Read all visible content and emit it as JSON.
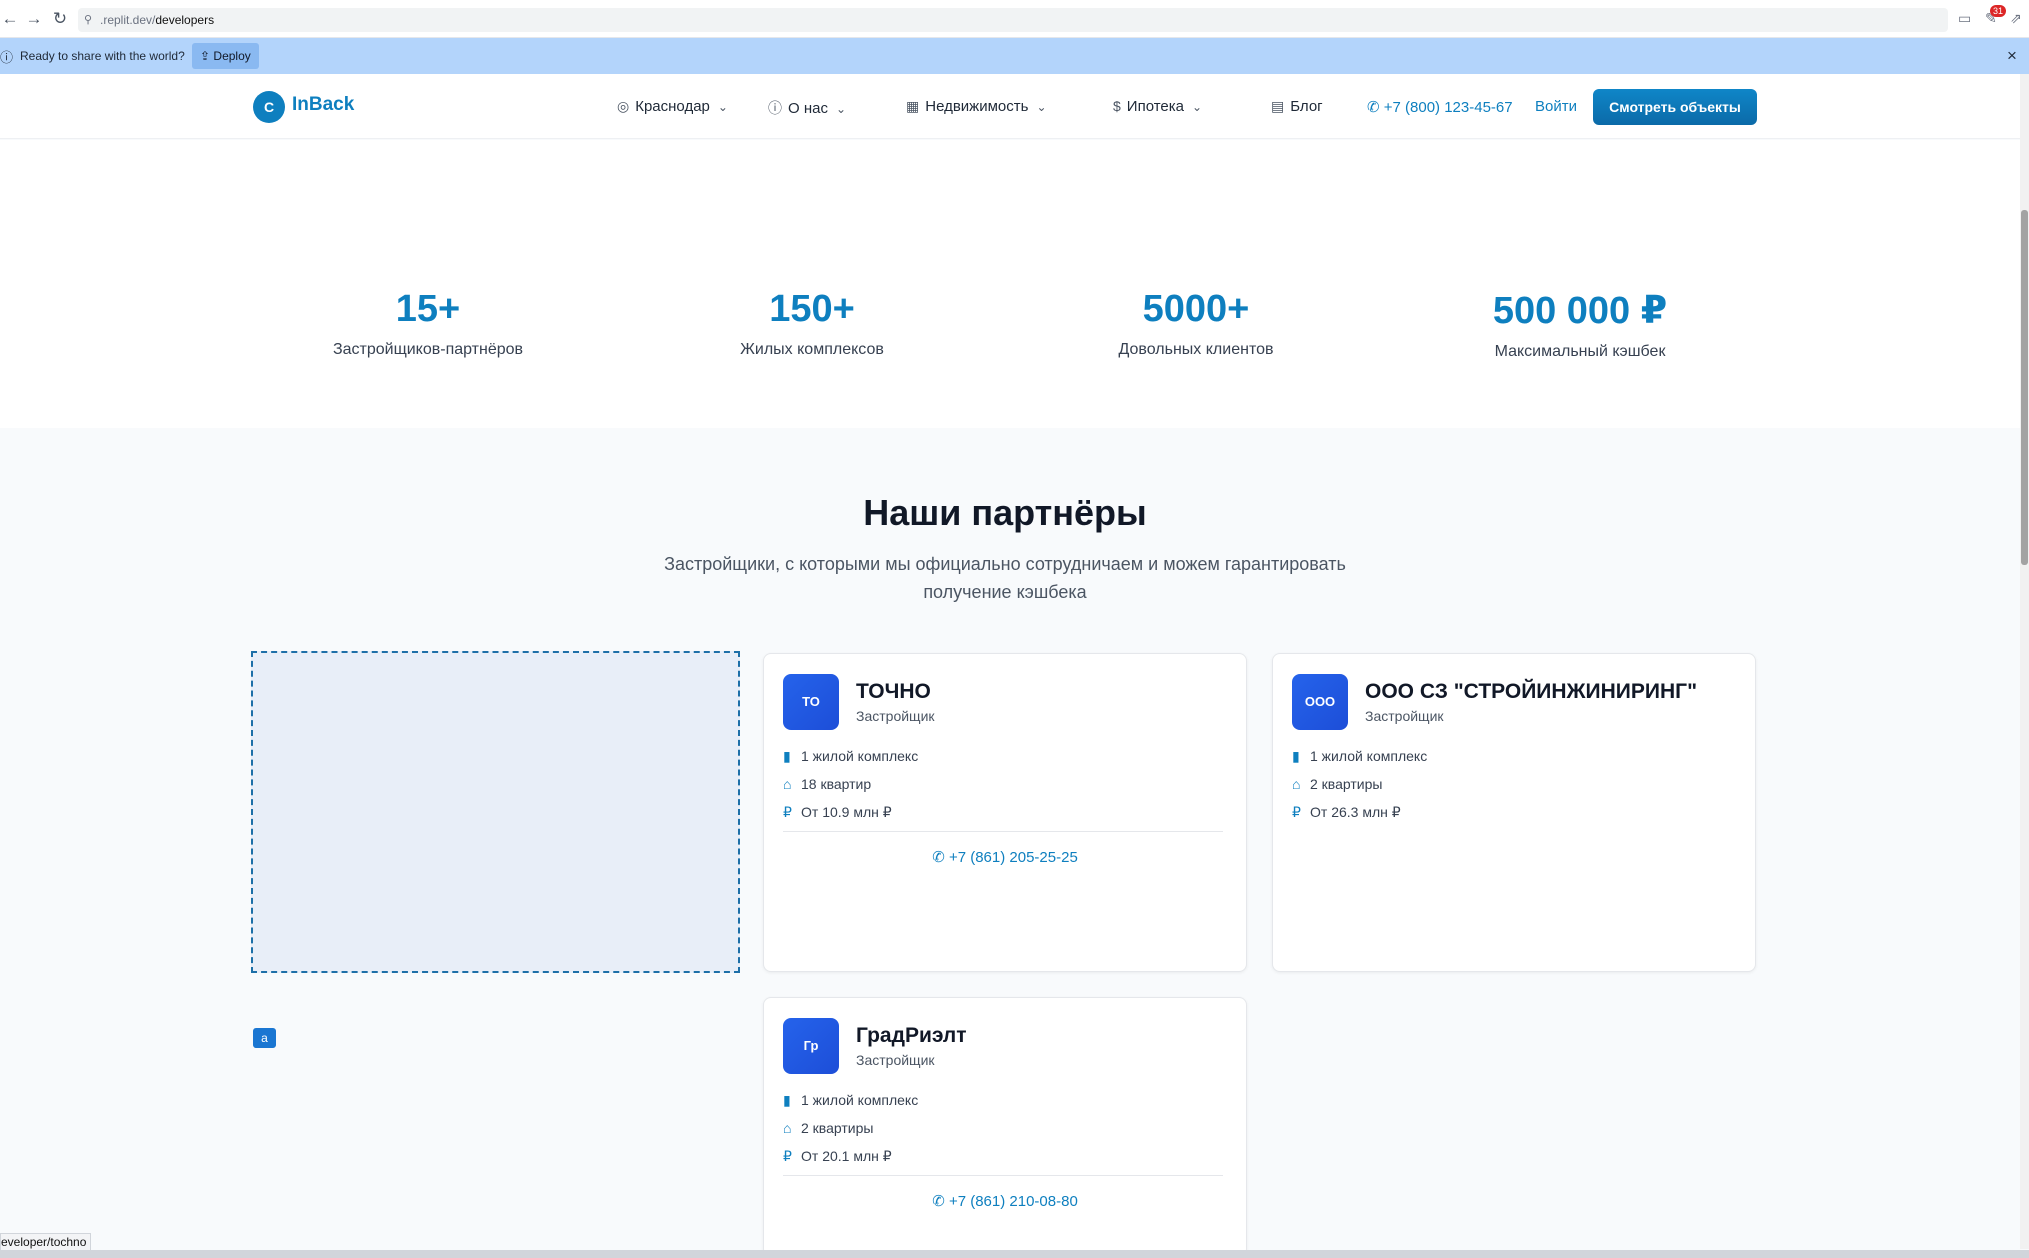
{
  "browser": {
    "url_prefix": ".replit.dev/",
    "url_path": "developers",
    "extension_badge": "31"
  },
  "notice": {
    "text": "Ready to share with the world?",
    "deploy_label": "Deploy"
  },
  "header": {
    "logo_letter": "C",
    "logo_text": "InBack",
    "nav": [
      {
        "icon": "map-pin-icon",
        "label": "Краснодар"
      },
      {
        "icon": "info-icon",
        "label": "О нас"
      },
      {
        "icon": "building-icon",
        "label": "Недвижимость"
      },
      {
        "icon": "dollar-icon",
        "label": "Ипотека"
      },
      {
        "icon": "blog-icon",
        "label": "Блог"
      }
    ],
    "phone": "+7 (800) 123-45-67",
    "login": "Войти",
    "cta": "Смотреть объекты"
  },
  "stats": [
    {
      "value": "15+",
      "label": "Застройщиков-партнёров"
    },
    {
      "value": "150+",
      "label": "Жилых комплексов"
    },
    {
      "value": "5000+",
      "label": "Довольных клиентов"
    },
    {
      "value": "500 000 ₽",
      "label": "Максимальный кэшбек"
    }
  ],
  "partners": {
    "title": "Наши партнёры",
    "subtitle": "Застройщики, с которыми мы официально сотрудничаем и можем гарантировать получение кэшбека",
    "badge": "a",
    "cards": [
      {
        "avatar": "ТО",
        "name": "ТОЧНО",
        "role": "Застройщик",
        "complexes": "1 жилой комплекс",
        "flats": "18 квартир",
        "price": "От 10.9 млн ₽",
        "phone": "+7 (861) 205-25-25"
      },
      {
        "avatar": "ООО",
        "name": "ООО СЗ \"СТРОЙИНЖИНИРИНГ\"",
        "role": "Застройщик",
        "complexes": "1 жилой комплекс",
        "flats": "2 квартиры",
        "price": "От 26.3 млн ₽",
        "phone": ""
      },
      {
        "avatar": "Гр",
        "name": "ГрадРиэлт",
        "role": "Застройщик",
        "complexes": "1 жилой комплекс",
        "flats": "2 квартиры",
        "price": "От 20.1 млн ₽",
        "phone": "+7 (861) 210-08-80"
      }
    ]
  },
  "status_bar_url": "eveloper/tochno"
}
